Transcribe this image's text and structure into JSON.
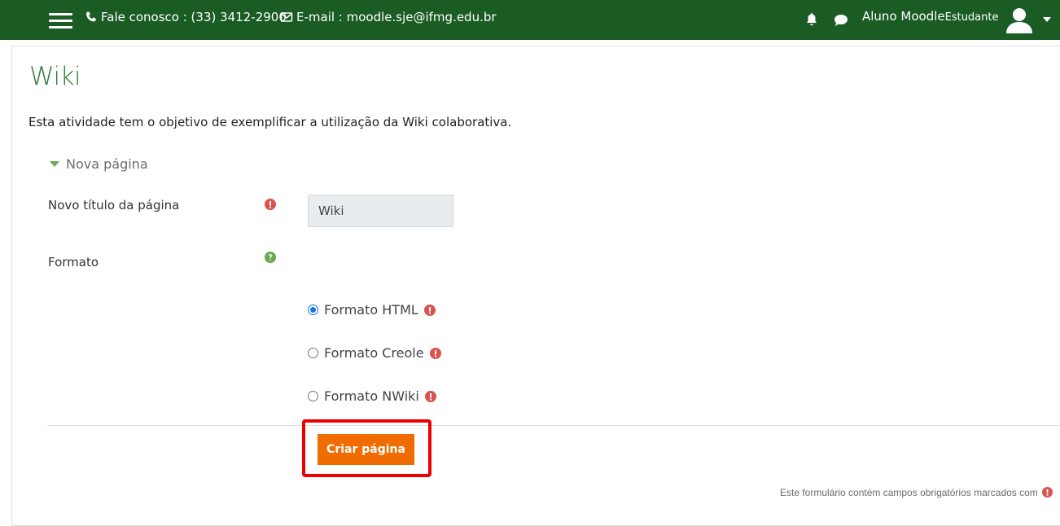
{
  "header": {
    "phone_text": "Fale conosco : (33) 3412-2900",
    "email_text": "E-mail : moodle.sje@ifmg.edu.br",
    "user_name": "Aluno Moodle",
    "user_role": "Estudante"
  },
  "page": {
    "title": "Wiki",
    "intro": "Esta atividade tem o objetivo de exemplificar a utilização da Wiki colaborativa."
  },
  "form": {
    "section_label": "Nova página",
    "title_label": "Novo título da página",
    "title_value": "Wiki",
    "format_label": "Formato",
    "formats": [
      {
        "label": "Formato HTML",
        "checked": true
      },
      {
        "label": "Formato Creole",
        "checked": false
      },
      {
        "label": "Formato NWiki",
        "checked": false
      }
    ],
    "submit_label": "Criar página",
    "required_note": "Este formulário contém campos obrigatórios marcados com"
  },
  "colors": {
    "navbar": "#1a5c24",
    "title": "#2f7d32",
    "button": "#f06c00",
    "required": "#d9534f",
    "help": "#6aa84f"
  }
}
